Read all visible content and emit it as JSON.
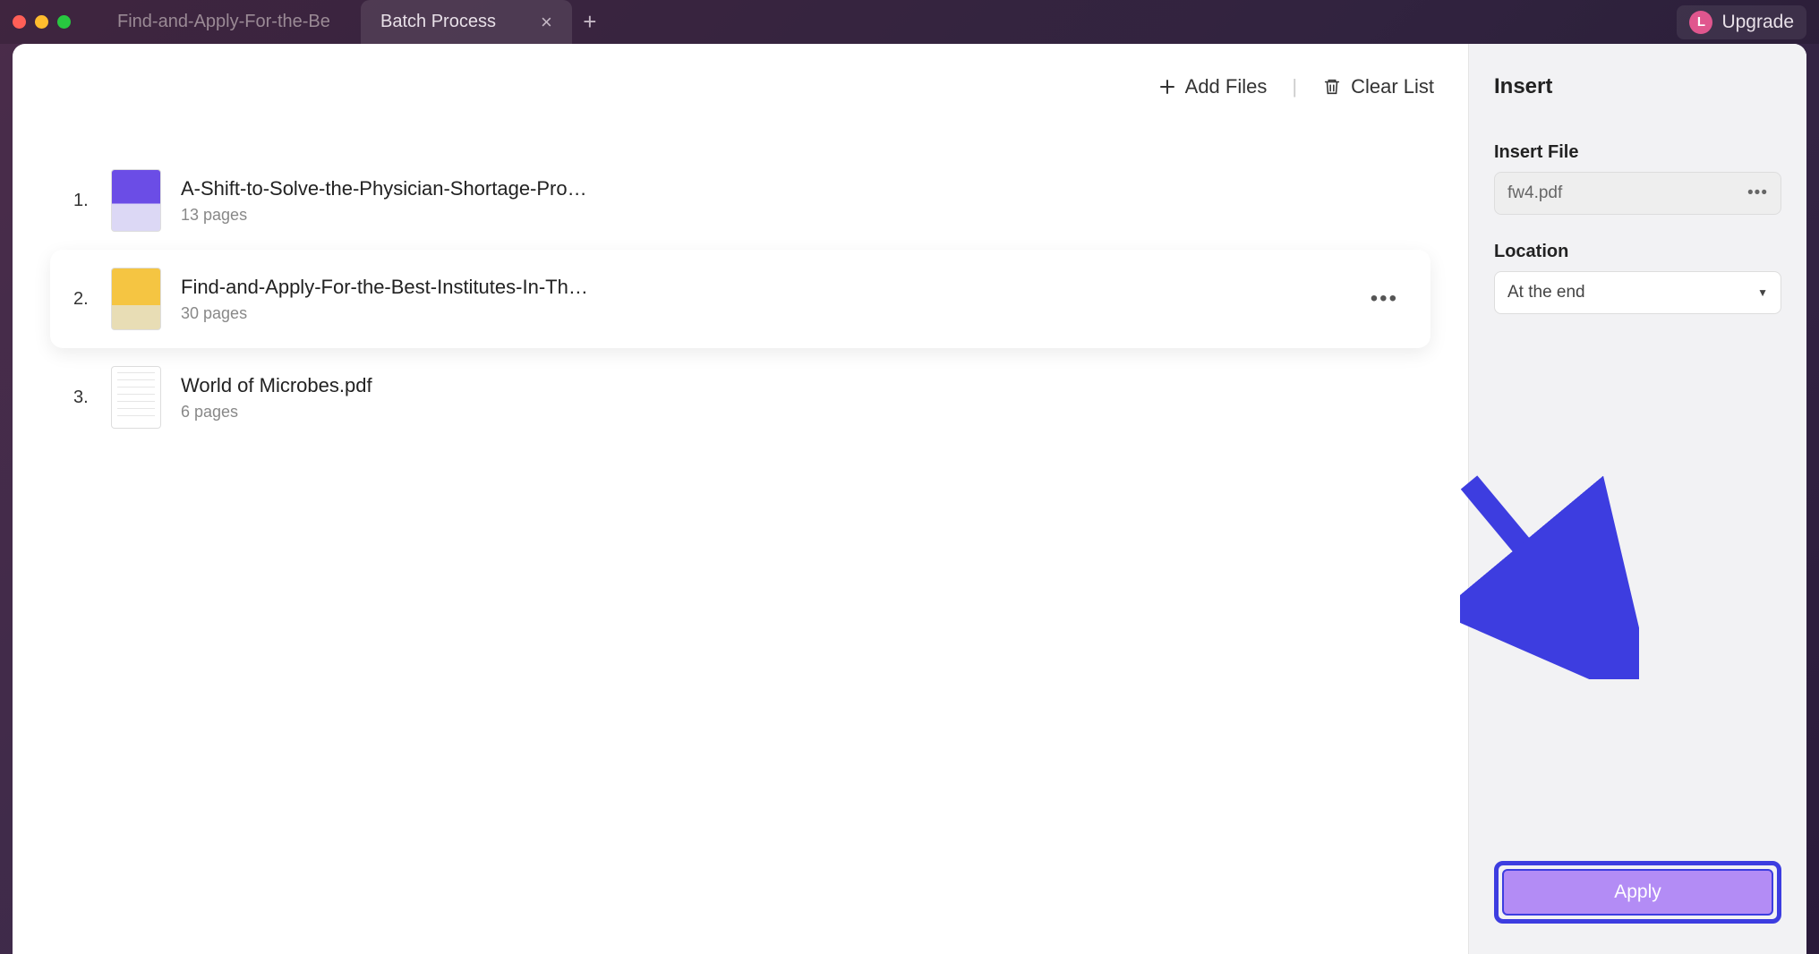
{
  "titlebar": {
    "tabs": [
      {
        "label": "Find-and-Apply-For-the-Be",
        "active": false
      },
      {
        "label": "Batch Process",
        "active": true
      }
    ],
    "upgrade_label": "Upgrade",
    "avatar_letter": "L"
  },
  "toolbar": {
    "add_files": "Add Files",
    "clear_list": "Clear List"
  },
  "files": [
    {
      "num": "1.",
      "name": "A-Shift-to-Solve-the-Physician-Shortage-Problem-ar",
      "pages": "13 pages",
      "thumb": "purple",
      "selected": false
    },
    {
      "num": "2.",
      "name": "Find-and-Apply-For-the-Best-Institutes-In-The-World",
      "pages": "30 pages",
      "thumb": "yellow",
      "selected": true
    },
    {
      "num": "3.",
      "name": "World of Microbes.pdf",
      "pages": "6 pages",
      "thumb": "white",
      "selected": false
    }
  ],
  "panel": {
    "title": "Insert",
    "insert_file_label": "Insert File",
    "insert_file_value": "fw4.pdf",
    "location_label": "Location",
    "location_value": "At the end",
    "apply_label": "Apply"
  }
}
